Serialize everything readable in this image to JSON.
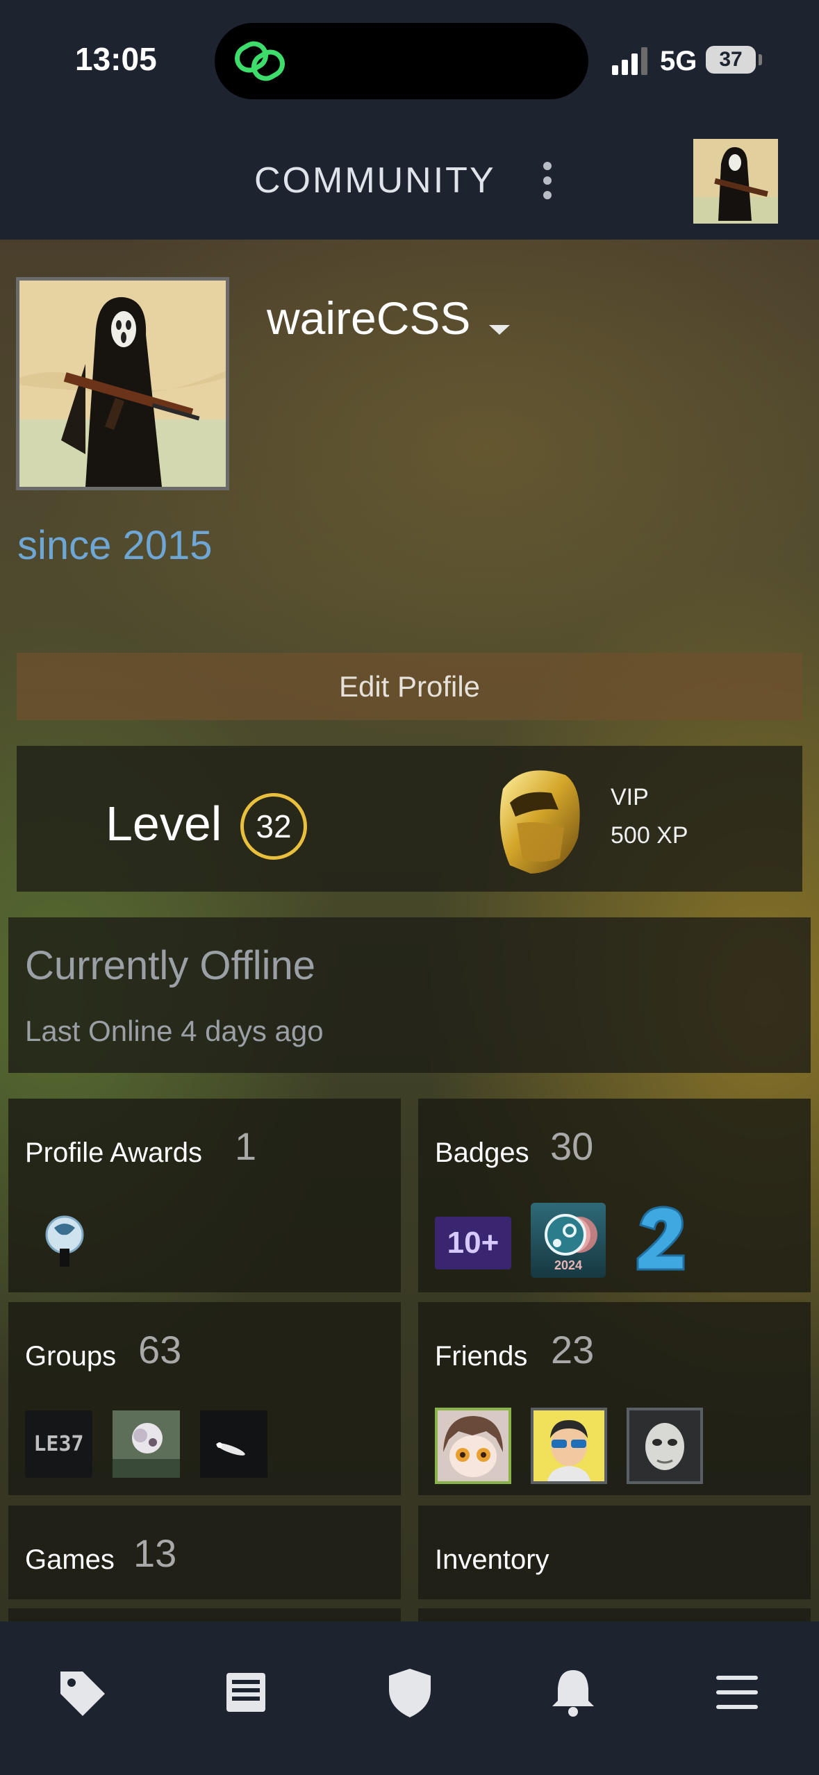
{
  "status_bar": {
    "time": "13:05",
    "network": "5G",
    "battery": "37",
    "island_icon": "app-link-icon"
  },
  "header": {
    "title": "COMMUNITY",
    "menu_icon": "kebab-icon"
  },
  "profile": {
    "username": "waireCSS",
    "since": "since 2015",
    "edit_label": "Edit Profile"
  },
  "level": {
    "label": "Level",
    "value": "32",
    "badge_name": "VIP",
    "xp": "500 XP"
  },
  "status": {
    "title": "Currently Offline",
    "last_online": "Last Online 4 days ago"
  },
  "tiles": {
    "awards": {
      "label": "Profile Awards",
      "count": "1"
    },
    "badges": {
      "label": "Badges",
      "count": "30",
      "items": [
        "10+",
        "2024"
      ]
    },
    "groups": {
      "label": "Groups",
      "count": "63",
      "items": [
        "LE37"
      ]
    },
    "friends": {
      "label": "Friends",
      "count": "23"
    },
    "games": {
      "label": "Games",
      "count": "13"
    },
    "inventory": {
      "label": "Inventory"
    }
  },
  "bottom_nav": [
    "tag-icon",
    "news-icon",
    "shield-icon",
    "bell-icon",
    "menu-icon"
  ],
  "colors": {
    "header_bg": "#1e2330",
    "accent_blue": "#6ea7d6",
    "level_ring": "#e9bf3e",
    "muted_text": "#9aa0a6"
  }
}
